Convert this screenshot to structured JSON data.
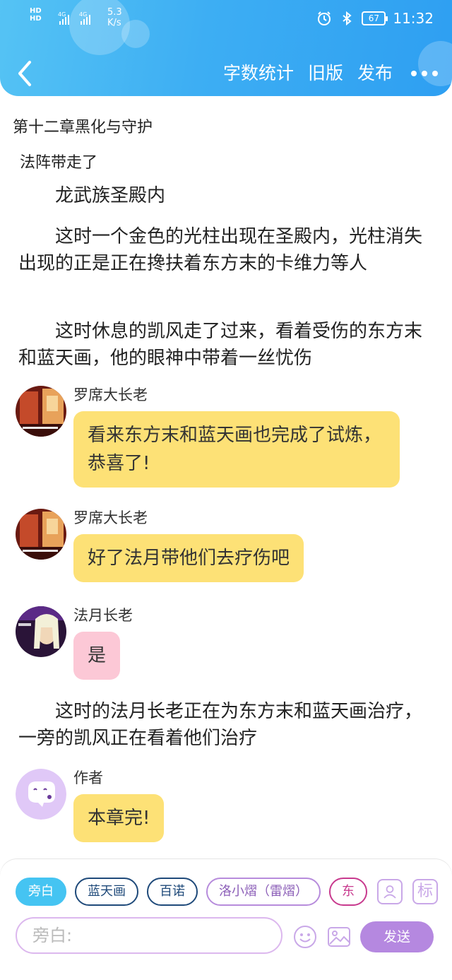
{
  "status_bar": {
    "hd1": "HD",
    "hd2": "HD",
    "net1": "4G",
    "net2": "4G",
    "speed_value": "5.3",
    "speed_unit": "K/s",
    "battery": "67",
    "time": "11:32"
  },
  "nav": {
    "word_count": "字数统计",
    "old_version": "旧版",
    "publish": "发布"
  },
  "chapter": {
    "title": "第十二章黑化与守护",
    "subtitle": "法阵带走了"
  },
  "paragraphs": [
    "龙武族圣殿内",
    "这时一个金色的光柱出现在圣殿内，光柱消失出现的正是正在搀扶着东方末的卡维力等人",
    "这时休息的凯风走了过来，看着受伤的东方末和蓝天画，他的眼神中带着一丝忧伤",
    "这时的法月长老正在为东方末和蓝天画治疗，一旁的凯风正在看着他们治疗"
  ],
  "messages": [
    {
      "sender": "罗席大长老",
      "text": "看来东方末和蓝天画也完成了试炼，恭喜了!"
    },
    {
      "sender": "罗席大长老",
      "text": "好了法月带他们去疗伤吧"
    },
    {
      "sender": "法月长老",
      "text": "是"
    },
    {
      "sender": "作者",
      "text": "本章完!"
    }
  ],
  "composer": {
    "roles": [
      "旁白",
      "蓝天画",
      "百诺",
      "洛小熠（雷熠）",
      "东"
    ],
    "placeholder": "旁白:",
    "send": "发送",
    "mark_label": "标"
  },
  "colors": {
    "header": "#3daef3",
    "bubble_yellow": "#fde176",
    "bubble_pink": "#fcc8d6",
    "send": "#b588e0",
    "active_chip": "#45c4f2"
  },
  "icons": [
    "back-arrow-icon",
    "more-icon",
    "alarm-icon",
    "bluetooth-icon",
    "person-card-icon",
    "emoji-icon",
    "image-icon",
    "chat-bubble-icon"
  ]
}
